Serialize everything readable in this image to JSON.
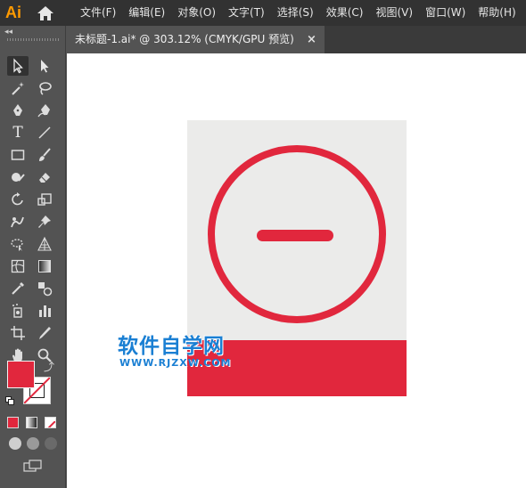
{
  "app": {
    "logo": "Ai"
  },
  "menu": [
    "文件(F)",
    "编辑(E)",
    "对象(O)",
    "文字(T)",
    "选择(S)",
    "效果(C)",
    "视图(V)",
    "窗口(W)",
    "帮助(H)"
  ],
  "tab": {
    "title": "未标题-1.ai* @ 303.12% (CMYK/GPU 预览)",
    "close": "×"
  },
  "toolbar": {
    "collapse": "◂◂",
    "type_tool_glyph": "T",
    "fill_color": "#e1273d",
    "stroke_color": "none"
  },
  "artwork": {
    "background": "#ebebea",
    "accent": "#e1273d",
    "shape": "minus-circle-icon"
  },
  "watermark": {
    "text": "软件自学网",
    "url": "WWW.RJZXW.COM"
  }
}
